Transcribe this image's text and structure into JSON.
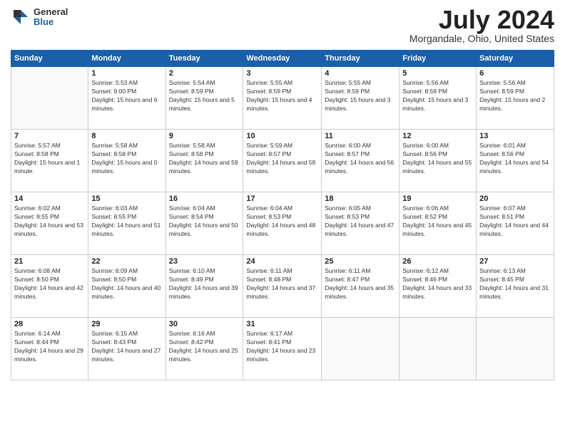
{
  "header": {
    "logo": {
      "general": "General",
      "blue": "Blue"
    },
    "title": "July 2024",
    "location": "Morgandale, Ohio, United States"
  },
  "weekdays": [
    "Sunday",
    "Monday",
    "Tuesday",
    "Wednesday",
    "Thursday",
    "Friday",
    "Saturday"
  ],
  "weeks": [
    [
      {
        "day": "",
        "sunrise": "",
        "sunset": "",
        "daylight": ""
      },
      {
        "day": "1",
        "sunrise": "Sunrise: 5:53 AM",
        "sunset": "Sunset: 9:00 PM",
        "daylight": "Daylight: 15 hours and 6 minutes."
      },
      {
        "day": "2",
        "sunrise": "Sunrise: 5:54 AM",
        "sunset": "Sunset: 8:59 PM",
        "daylight": "Daylight: 15 hours and 5 minutes."
      },
      {
        "day": "3",
        "sunrise": "Sunrise: 5:55 AM",
        "sunset": "Sunset: 8:59 PM",
        "daylight": "Daylight: 15 hours and 4 minutes."
      },
      {
        "day": "4",
        "sunrise": "Sunrise: 5:55 AM",
        "sunset": "Sunset: 8:59 PM",
        "daylight": "Daylight: 15 hours and 3 minutes."
      },
      {
        "day": "5",
        "sunrise": "Sunrise: 5:56 AM",
        "sunset": "Sunset: 8:59 PM",
        "daylight": "Daylight: 15 hours and 3 minutes."
      },
      {
        "day": "6",
        "sunrise": "Sunrise: 5:56 AM",
        "sunset": "Sunset: 8:59 PM",
        "daylight": "Daylight: 15 hours and 2 minutes."
      }
    ],
    [
      {
        "day": "7",
        "sunrise": "Sunrise: 5:57 AM",
        "sunset": "Sunset: 8:58 PM",
        "daylight": "Daylight: 15 hours and 1 minute."
      },
      {
        "day": "8",
        "sunrise": "Sunrise: 5:58 AM",
        "sunset": "Sunset: 8:58 PM",
        "daylight": "Daylight: 15 hours and 0 minutes."
      },
      {
        "day": "9",
        "sunrise": "Sunrise: 5:58 AM",
        "sunset": "Sunset: 8:58 PM",
        "daylight": "Daylight: 14 hours and 59 minutes."
      },
      {
        "day": "10",
        "sunrise": "Sunrise: 5:59 AM",
        "sunset": "Sunset: 8:57 PM",
        "daylight": "Daylight: 14 hours and 58 minutes."
      },
      {
        "day": "11",
        "sunrise": "Sunrise: 6:00 AM",
        "sunset": "Sunset: 8:57 PM",
        "daylight": "Daylight: 14 hours and 56 minutes."
      },
      {
        "day": "12",
        "sunrise": "Sunrise: 6:00 AM",
        "sunset": "Sunset: 8:56 PM",
        "daylight": "Daylight: 14 hours and 55 minutes."
      },
      {
        "day": "13",
        "sunrise": "Sunrise: 6:01 AM",
        "sunset": "Sunset: 8:56 PM",
        "daylight": "Daylight: 14 hours and 54 minutes."
      }
    ],
    [
      {
        "day": "14",
        "sunrise": "Sunrise: 6:02 AM",
        "sunset": "Sunset: 8:55 PM",
        "daylight": "Daylight: 14 hours and 53 minutes."
      },
      {
        "day": "15",
        "sunrise": "Sunrise: 6:03 AM",
        "sunset": "Sunset: 8:55 PM",
        "daylight": "Daylight: 14 hours and 51 minutes."
      },
      {
        "day": "16",
        "sunrise": "Sunrise: 6:04 AM",
        "sunset": "Sunset: 8:54 PM",
        "daylight": "Daylight: 14 hours and 50 minutes."
      },
      {
        "day": "17",
        "sunrise": "Sunrise: 6:04 AM",
        "sunset": "Sunset: 8:53 PM",
        "daylight": "Daylight: 14 hours and 48 minutes."
      },
      {
        "day": "18",
        "sunrise": "Sunrise: 6:05 AM",
        "sunset": "Sunset: 8:53 PM",
        "daylight": "Daylight: 14 hours and 47 minutes."
      },
      {
        "day": "19",
        "sunrise": "Sunrise: 6:06 AM",
        "sunset": "Sunset: 8:52 PM",
        "daylight": "Daylight: 14 hours and 45 minutes."
      },
      {
        "day": "20",
        "sunrise": "Sunrise: 6:07 AM",
        "sunset": "Sunset: 8:51 PM",
        "daylight": "Daylight: 14 hours and 44 minutes."
      }
    ],
    [
      {
        "day": "21",
        "sunrise": "Sunrise: 6:08 AM",
        "sunset": "Sunset: 8:50 PM",
        "daylight": "Daylight: 14 hours and 42 minutes."
      },
      {
        "day": "22",
        "sunrise": "Sunrise: 6:09 AM",
        "sunset": "Sunset: 8:50 PM",
        "daylight": "Daylight: 14 hours and 40 minutes."
      },
      {
        "day": "23",
        "sunrise": "Sunrise: 6:10 AM",
        "sunset": "Sunset: 8:49 PM",
        "daylight": "Daylight: 14 hours and 39 minutes."
      },
      {
        "day": "24",
        "sunrise": "Sunrise: 6:11 AM",
        "sunset": "Sunset: 8:48 PM",
        "daylight": "Daylight: 14 hours and 37 minutes."
      },
      {
        "day": "25",
        "sunrise": "Sunrise: 6:11 AM",
        "sunset": "Sunset: 8:47 PM",
        "daylight": "Daylight: 14 hours and 35 minutes."
      },
      {
        "day": "26",
        "sunrise": "Sunrise: 6:12 AM",
        "sunset": "Sunset: 8:46 PM",
        "daylight": "Daylight: 14 hours and 33 minutes."
      },
      {
        "day": "27",
        "sunrise": "Sunrise: 6:13 AM",
        "sunset": "Sunset: 8:45 PM",
        "daylight": "Daylight: 14 hours and 31 minutes."
      }
    ],
    [
      {
        "day": "28",
        "sunrise": "Sunrise: 6:14 AM",
        "sunset": "Sunset: 8:44 PM",
        "daylight": "Daylight: 14 hours and 29 minutes."
      },
      {
        "day": "29",
        "sunrise": "Sunrise: 6:15 AM",
        "sunset": "Sunset: 8:43 PM",
        "daylight": "Daylight: 14 hours and 27 minutes."
      },
      {
        "day": "30",
        "sunrise": "Sunrise: 6:16 AM",
        "sunset": "Sunset: 8:42 PM",
        "daylight": "Daylight: 14 hours and 25 minutes."
      },
      {
        "day": "31",
        "sunrise": "Sunrise: 6:17 AM",
        "sunset": "Sunset: 8:41 PM",
        "daylight": "Daylight: 14 hours and 23 minutes."
      },
      {
        "day": "",
        "sunrise": "",
        "sunset": "",
        "daylight": ""
      },
      {
        "day": "",
        "sunrise": "",
        "sunset": "",
        "daylight": ""
      },
      {
        "day": "",
        "sunrise": "",
        "sunset": "",
        "daylight": ""
      }
    ]
  ]
}
